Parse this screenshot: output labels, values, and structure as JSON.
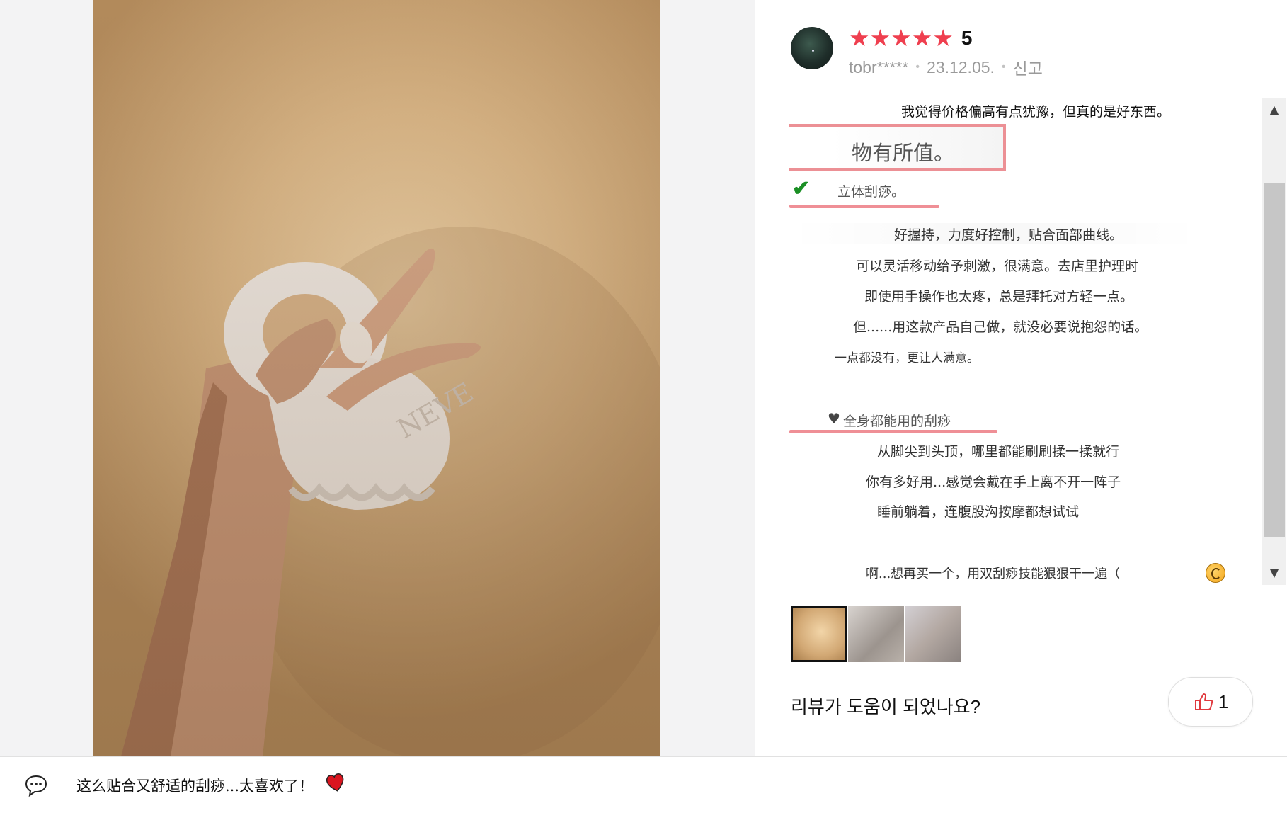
{
  "review": {
    "rating_stars": "★★★★★",
    "rating_value": "5",
    "username": "tobr*****",
    "date": "23.12.05.",
    "report_label": "신고",
    "separator": "•",
    "body": {
      "intro": "我觉得价格偏高有点犹豫，但真的是好东西。",
      "highlight": "物有所值。",
      "section1_check": "✔",
      "section1_heading": "立体刮痧。",
      "section1_lines": [
        "好握持，力度好控制，贴合面部曲线。",
        "可以灵活移动给予刺激，很满意。去店里护理时",
        "即使用手操作也太疼，总是拜托对方轻一点。",
        "但......用这款产品自己做，就没必要说抱怨的话。",
        "一点都没有，更让人满意。"
      ],
      "section2_heart": "♥",
      "section2_heading": "全身都能用的刮痧",
      "section2_lines": [
        "从脚尖到头顶，哪里都能刷刷揉一揉就行",
        "你有多好用...感觉会戴在手上离不开一阵子",
        "睡前躺着，连腹股沟按摩都想试试"
      ],
      "closing": "啊...想再买一个，用双刮痧技能狠狠干一遍（"
    },
    "scroll_up": "▲",
    "scroll_down": "▼",
    "thumbnail_count": 3,
    "helpful_question": "리뷰가 도움이 되었나요?",
    "like_count": "1"
  },
  "bottom_bar": {
    "caption": "这么贴合又舒适的刮痧...太喜欢了！"
  },
  "colors": {
    "star": "#ef3f4f",
    "highlight_border": "#ec9095",
    "underline": "#ef8f96",
    "check": "#1a8f24",
    "like_icon": "#e0393e"
  }
}
